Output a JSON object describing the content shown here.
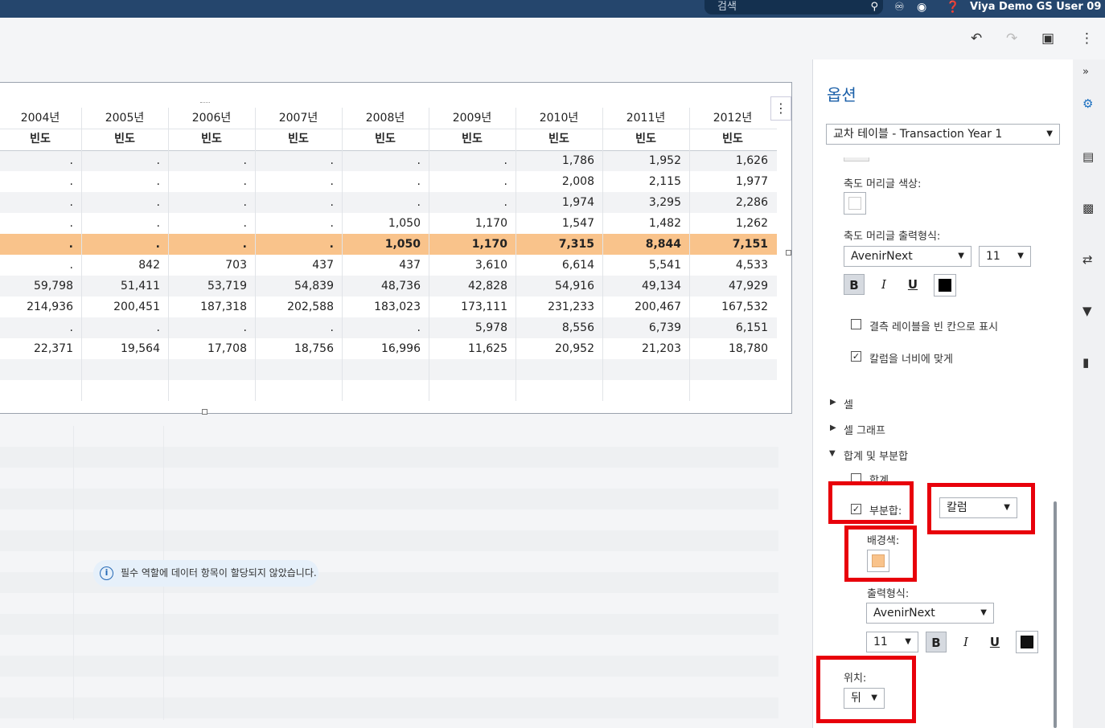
{
  "topbar": {
    "search_placeholder": "검색",
    "user_name": "Viya Demo GS User 09",
    "icons": [
      "search-icon",
      "history-icon",
      "bell-icon",
      "help-icon",
      "chevron-down-icon"
    ]
  },
  "toolbar": {
    "icons": [
      "undo-icon",
      "redo-icon",
      "save-icon",
      "more-vert-icon"
    ]
  },
  "table": {
    "columns": [
      "2004년",
      "2005년",
      "2006년",
      "2007년",
      "2008년",
      "2009년",
      "2010년",
      "2011년",
      "2012년"
    ],
    "subheader": "빈도",
    "rows": [
      [
        ".",
        ".",
        ".",
        ".",
        ".",
        ".",
        "1,786",
        "1,952",
        "1,626"
      ],
      [
        ".",
        ".",
        ".",
        ".",
        ".",
        ".",
        "2,008",
        "2,115",
        "1,977"
      ],
      [
        ".",
        ".",
        ".",
        ".",
        ".",
        ".",
        "1,974",
        "3,295",
        "2,286"
      ],
      [
        ".",
        ".",
        ".",
        ".",
        "1,050",
        "1,170",
        "1,547",
        "1,482",
        "1,262"
      ],
      [
        ".",
        ".",
        ".",
        ".",
        "1,050",
        "1,170",
        "7,315",
        "8,844",
        "7,151"
      ],
      [
        ".",
        "842",
        "703",
        "437",
        "437",
        "3,610",
        "6,614",
        "5,541",
        "4,533"
      ],
      [
        "59,798",
        "51,411",
        "53,719",
        "54,839",
        "48,736",
        "42,828",
        "54,916",
        "49,134",
        "47,929"
      ],
      [
        "214,936",
        "200,451",
        "187,318",
        "202,588",
        "183,023",
        "173,111",
        "231,233",
        "200,467",
        "167,532"
      ],
      [
        ".",
        ".",
        ".",
        ".",
        ".",
        "5,978",
        "8,556",
        "6,739",
        "6,151"
      ],
      [
        "22,371",
        "19,564",
        "17,708",
        "18,756",
        "16,996",
        "11,625",
        "20,952",
        "21,203",
        "18,780"
      ],
      [
        "",
        "",
        "",
        "",
        "",
        "",
        "",
        "",
        ""
      ],
      [
        "",
        "",
        "",
        "",
        "",
        "",
        "",
        "",
        ""
      ]
    ],
    "subtotal_row_index": 4,
    "subtotal_color": "#f9c38b"
  },
  "info_message": "필수 역할에 데이터 항목이 할당되지 않았습니다.",
  "panel": {
    "title": "옵션",
    "object_select": "교차 테이블 - Transaction Year 1",
    "axis_header_color_label": "축도 머리글 색상:",
    "axis_header_format_label": "축도 머리글 출력형식:",
    "axis_font": "AvenirNext",
    "axis_font_size": "11",
    "missing_label_text": "결측 레이블을 빈 칸으로 표시",
    "missing_label_checked": false,
    "fit_columns_text": "칼럼을 너비에 맞게",
    "fit_columns_checked": true,
    "section_cell": "셀",
    "section_cell_graph": "셀 그래프",
    "section_totals": "합계 및 부분합",
    "totals_label": "합계",
    "subtotals_label": "부분합:",
    "subtotals_checked": true,
    "subtotals_select": "칼럼",
    "bg_color_label": "배경색:",
    "bg_color": "#f9c38b",
    "format_label": "출력형식:",
    "sub_font": "AvenirNext",
    "sub_font_size": "11",
    "position_label": "위치:",
    "position_value": "뒤"
  },
  "rail_icons": [
    "collapse-icon",
    "options-icon",
    "data-icon",
    "roles-icon",
    "actions-icon",
    "filter-icon",
    "ranks-icon"
  ]
}
